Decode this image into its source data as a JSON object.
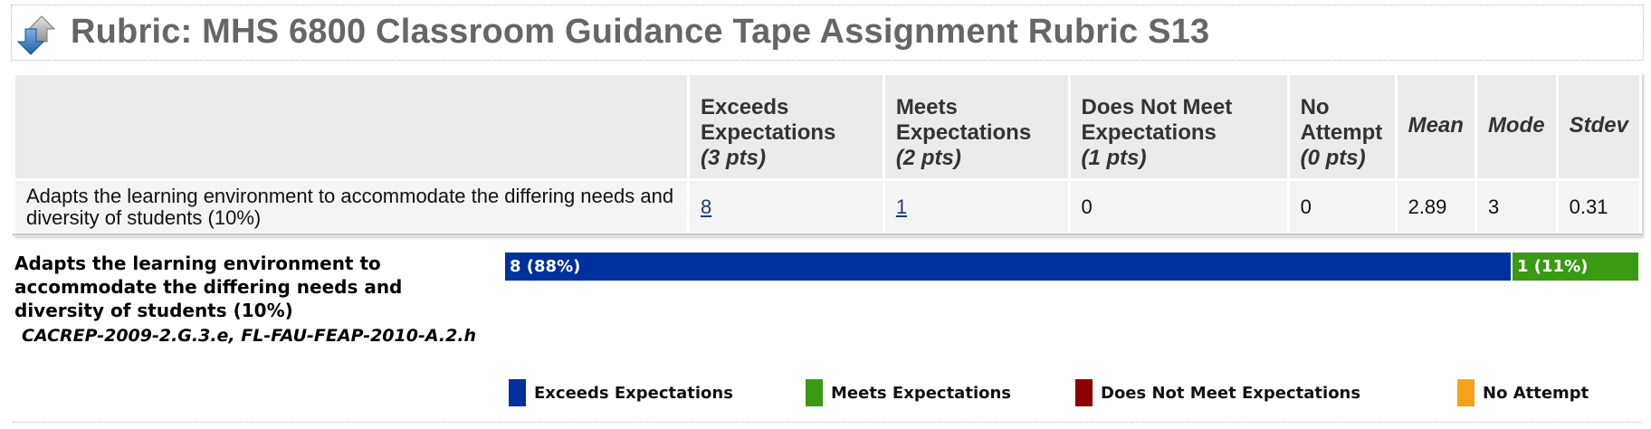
{
  "title": {
    "text": "Rubric: MHS 6800 Classroom Guidance Tape Assignment Rubric S13",
    "icon": "sort-arrows-icon"
  },
  "table": {
    "headers": {
      "criterion": "",
      "exceeds": {
        "label": "Exceeds Expectations",
        "pts": "(3 pts)"
      },
      "meets": {
        "label": "Meets Expectations",
        "pts": "(2 pts)"
      },
      "does_not_meet": {
        "label": "Does Not Meet Expectations",
        "pts": "(1 pts)"
      },
      "no_attempt": {
        "label": "No Attempt",
        "pts": "(0 pts)"
      },
      "mean": "Mean",
      "mode": "Mode",
      "stdev": "Stdev"
    },
    "rows": [
      {
        "criterion": "Adapts the learning environment to accommodate the differing needs and diversity of students (10%)",
        "exceeds": "8",
        "meets": "1",
        "does_not_meet": "0",
        "no_attempt": "0",
        "mean": "2.89",
        "mode": "3",
        "stdev": "0.31"
      }
    ]
  },
  "distribution": {
    "criterion": "Adapts the learning environment to accommodate the differing needs and diversity of students (10%)",
    "standards": "CACREP-2009-2.G.3.e, FL-FAU-FEAP-2010-A.2.h",
    "segments": [
      {
        "label": "8 (88%)",
        "fraction": 0.889,
        "color": "#00309b"
      },
      {
        "label": "1 (11%)",
        "fraction": 0.111,
        "color": "#3a9a14"
      }
    ]
  },
  "legend": [
    {
      "label": "Exceeds Expectations",
      "color": "#00309b"
    },
    {
      "label": "Meets Expectations",
      "color": "#3a9a14"
    },
    {
      "label": "Does Not Meet Expectations",
      "color": "#8b0000"
    },
    {
      "label": "No Attempt",
      "color": "#f7a11a"
    }
  ]
}
